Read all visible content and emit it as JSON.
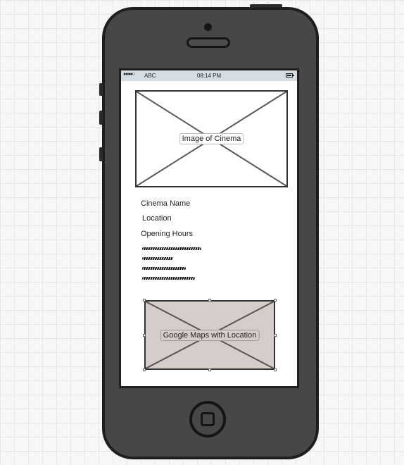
{
  "status_bar": {
    "signal": "●●●●○",
    "carrier": "ABC",
    "time": "08:14 PM"
  },
  "image_placeholder": {
    "label": "Image of Cinema"
  },
  "fields": {
    "name": "Cinema Name",
    "location": "Location",
    "opening_hours": "Opening Hours"
  },
  "map_placeholder": {
    "label": "Google Maps with Location"
  },
  "colors": {
    "phone_body": "#474747",
    "status_bar": "#d3dde3",
    "map_fill": "#d6cdcb"
  }
}
